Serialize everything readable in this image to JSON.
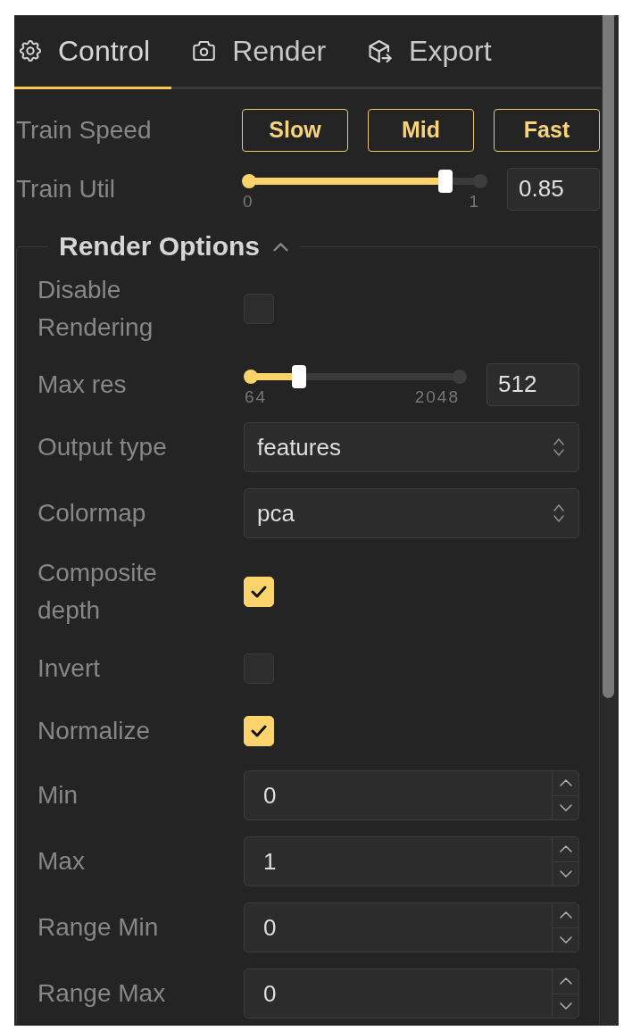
{
  "tabs": [
    {
      "label": "Control",
      "selected": true
    },
    {
      "label": "Render",
      "selected": false
    },
    {
      "label": "Export",
      "selected": false
    }
  ],
  "controls": [
    {
      "kind": "buttons",
      "label": "Train Speed",
      "buttons": [
        "Slow",
        "Mid",
        "Fast"
      ]
    },
    {
      "kind": "slider",
      "label": "Train Util",
      "level": 0.85,
      "min_label": "0",
      "max_label": "1",
      "value": "0.85"
    }
  ],
  "render_options": {
    "title": "Render Options",
    "expanded": true,
    "rows": [
      {
        "kind": "checkbox",
        "label": "Disable Rendering",
        "checked": false
      },
      {
        "kind": "slider",
        "label": "Max res",
        "level": 0.23,
        "min_label": "64",
        "max_label": "2048",
        "value": "512"
      },
      {
        "kind": "select",
        "label": "Output type",
        "value": "features"
      },
      {
        "kind": "select",
        "label": "Colormap",
        "value": "pca"
      },
      {
        "kind": "checkbox",
        "label": "Composite depth",
        "checked": true
      },
      {
        "kind": "checkbox",
        "label": "Invert",
        "checked": false
      },
      {
        "kind": "checkbox",
        "label": "Normalize",
        "checked": true
      },
      {
        "kind": "number",
        "label": "Min",
        "value": "0"
      },
      {
        "kind": "number",
        "label": "Max",
        "value": "1"
      },
      {
        "kind": "number",
        "label": "Range Min",
        "value": "0"
      },
      {
        "kind": "number",
        "label": "Range Max",
        "value": "0"
      }
    ]
  }
}
